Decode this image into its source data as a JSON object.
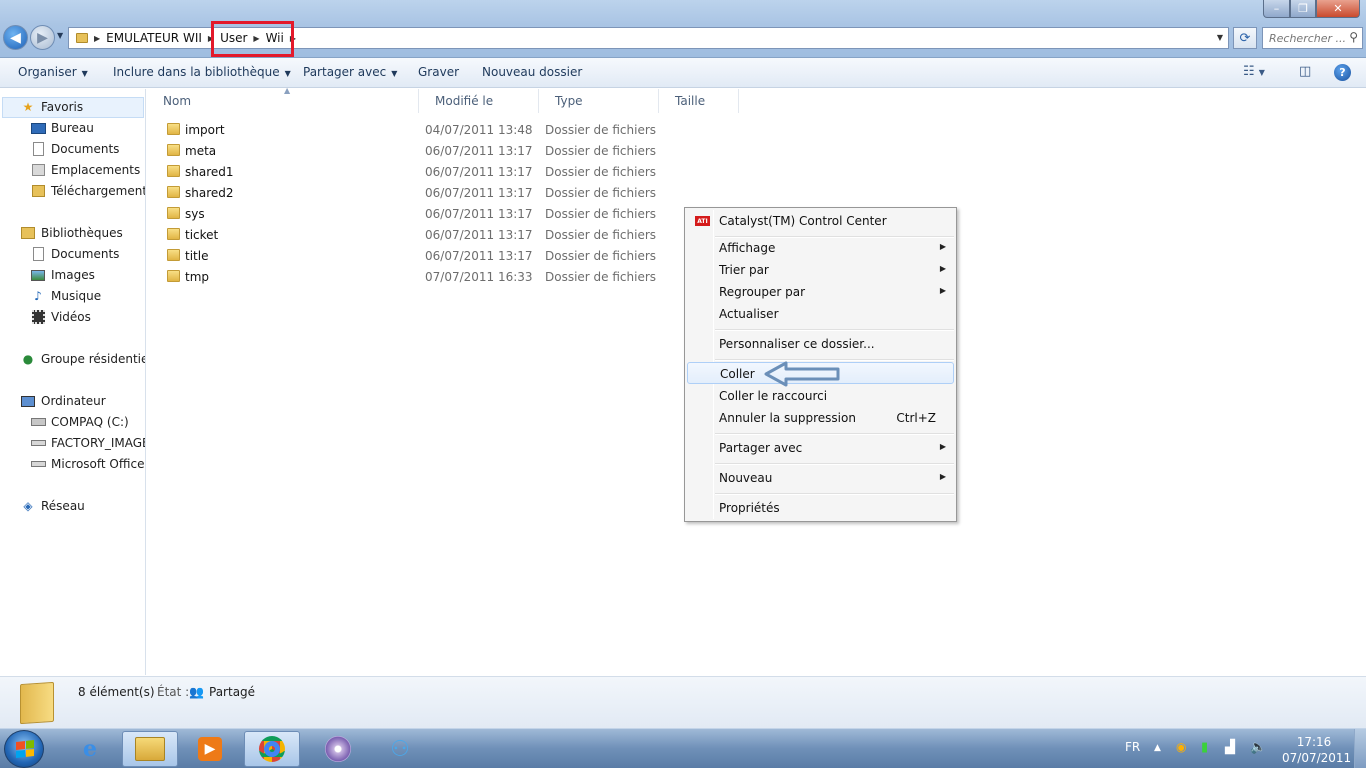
{
  "window": {
    "buttons": {
      "minimize": "–",
      "maximize": "❐",
      "close": "✕"
    }
  },
  "address_bar": {
    "crumbs": [
      "EMULATEUR WII",
      "User",
      "Wii"
    ],
    "search_placeholder": "Rechercher ..."
  },
  "toolbar": {
    "organize": "Organiser",
    "include_library": "Inclure dans la bibliothèque",
    "share_with": "Partager avec",
    "burn": "Graver",
    "new_folder": "Nouveau dossier",
    "help": "?"
  },
  "sidebar": {
    "favorites": {
      "title": "Favoris",
      "items": [
        "Bureau",
        "Documents",
        "Emplacements récents",
        "Téléchargements"
      ]
    },
    "libraries": {
      "title": "Bibliothèques",
      "items": [
        "Documents",
        "Images",
        "Musique",
        "Vidéos"
      ]
    },
    "homegroup": "Groupe résidentiel",
    "computer": {
      "title": "Ordinateur",
      "items": [
        "COMPAQ (C:)",
        "FACTORY_IMAGE",
        "Microsoft Office D"
      ]
    },
    "network": "Réseau"
  },
  "columns": {
    "name": "Nom",
    "modified": "Modifié le",
    "type": "Type",
    "size": "Taille"
  },
  "files": [
    {
      "name": "import",
      "date": "04/07/2011 13:48",
      "type": "Dossier de fichiers"
    },
    {
      "name": "meta",
      "date": "06/07/2011 13:17",
      "type": "Dossier de fichiers"
    },
    {
      "name": "shared1",
      "date": "06/07/2011 13:17",
      "type": "Dossier de fichiers"
    },
    {
      "name": "shared2",
      "date": "06/07/2011 13:17",
      "type": "Dossier de fichiers"
    },
    {
      "name": "sys",
      "date": "06/07/2011 13:17",
      "type": "Dossier de fichiers"
    },
    {
      "name": "ticket",
      "date": "06/07/2011 13:17",
      "type": "Dossier de fichiers"
    },
    {
      "name": "title",
      "date": "06/07/2011 13:17",
      "type": "Dossier de fichiers"
    },
    {
      "name": "tmp",
      "date": "07/07/2011 16:33",
      "type": "Dossier de fichiers"
    }
  ],
  "context_menu": {
    "catalyst": "Catalyst(TM) Control Center",
    "view": "Affichage",
    "sort_by": "Trier par",
    "group_by": "Regrouper par",
    "refresh": "Actualiser",
    "customize": "Personnaliser ce dossier...",
    "paste": "Coller",
    "paste_shortcut": "Coller le raccourci",
    "undo_delete": "Annuler la suppression",
    "undo_shortcut": "Ctrl+Z",
    "share_with": "Partager avec",
    "new": "Nouveau",
    "properties": "Propriétés",
    "ati_badge": "ATI"
  },
  "status": {
    "count": "8 élément(s)",
    "state_label": "État :",
    "state_value": "Partagé"
  },
  "taskbar": {
    "language": "FR",
    "time": "17:16",
    "date": "07/07/2011"
  }
}
